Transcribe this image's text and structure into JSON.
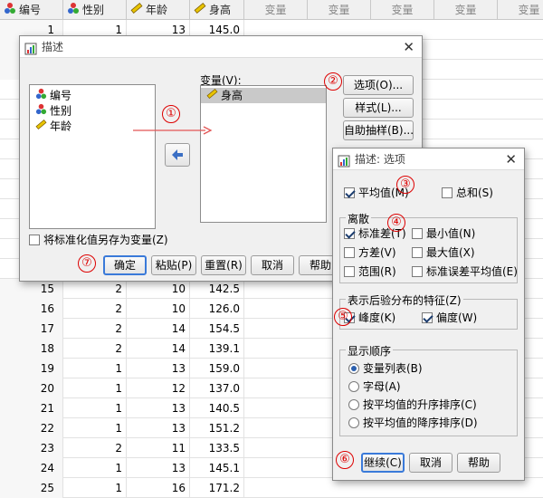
{
  "spreadsheet": {
    "columns": [
      "编号",
      "性别",
      "年龄",
      "身高",
      "变量",
      "变量",
      "变量",
      "变量",
      "变量"
    ],
    "top_rows": [
      [
        "1",
        "1",
        "13",
        "145.0"
      ]
    ],
    "rows": [
      [
        "15",
        "2",
        "10",
        "142.5"
      ],
      [
        "16",
        "2",
        "10",
        "126.0"
      ],
      [
        "17",
        "2",
        "14",
        "154.5"
      ],
      [
        "18",
        "2",
        "14",
        "139.1"
      ],
      [
        "19",
        "1",
        "13",
        "159.0"
      ],
      [
        "20",
        "1",
        "12",
        "137.0"
      ],
      [
        "21",
        "1",
        "13",
        "140.5"
      ],
      [
        "22",
        "1",
        "13",
        "151.2"
      ],
      [
        "23",
        "2",
        "11",
        "133.5"
      ],
      [
        "24",
        "1",
        "13",
        "145.1"
      ],
      [
        "25",
        "1",
        "16",
        "171.2"
      ]
    ]
  },
  "describe_dialog": {
    "title": "描述",
    "source_vars": [
      "编号",
      "性别",
      "年龄"
    ],
    "variables_label": "变量(V):",
    "selected_vars": [
      "身高"
    ],
    "save_standardized_label": "将标准化值另存为变量(Z)",
    "save_standardized_checked": false,
    "options_button": "选项(O)...",
    "style_button": "样式(L)...",
    "bootstrap_button": "自助抽样(B)...",
    "ok_button": "确定",
    "paste_button": "粘贴(P)",
    "reset_button": "重置(R)",
    "cancel_button": "取消",
    "help_button": "帮助"
  },
  "options_dialog": {
    "title": "描述: 选项",
    "mean_label": "平均值(M)",
    "mean_checked": true,
    "sum_label": "总和(S)",
    "sum_checked": false,
    "dispersion_title": "离散",
    "stddev_label": "标准差(T)",
    "stddev_checked": true,
    "min_label": "最小值(N)",
    "min_checked": false,
    "variance_label": "方差(V)",
    "variance_checked": false,
    "max_label": "最大值(X)",
    "max_checked": false,
    "range_label": "范围(R)",
    "range_checked": false,
    "semean_label": "标准误差平均值(E)",
    "semean_checked": false,
    "distribution_title": "表示后验分布的特征(Z)",
    "kurtosis_label": "峰度(K)",
    "kurtosis_checked": true,
    "skewness_label": "偏度(W)",
    "skewness_checked": true,
    "order_title": "显示顺序",
    "order_options": [
      "变量列表(B)",
      "字母(A)",
      "按平均值的升序排序(C)",
      "按平均值的降序排序(D)"
    ],
    "order_selected": 0,
    "continue_button": "继续(C)",
    "cancel_button": "取消",
    "help_button": "帮助"
  },
  "callouts": [
    "①",
    "②",
    "③",
    "④",
    "⑤",
    "⑥",
    "⑦"
  ],
  "colors": {
    "callout": "#dd0000",
    "default_button_border": "#3a7ad9",
    "selection": "#c9c9c9"
  }
}
